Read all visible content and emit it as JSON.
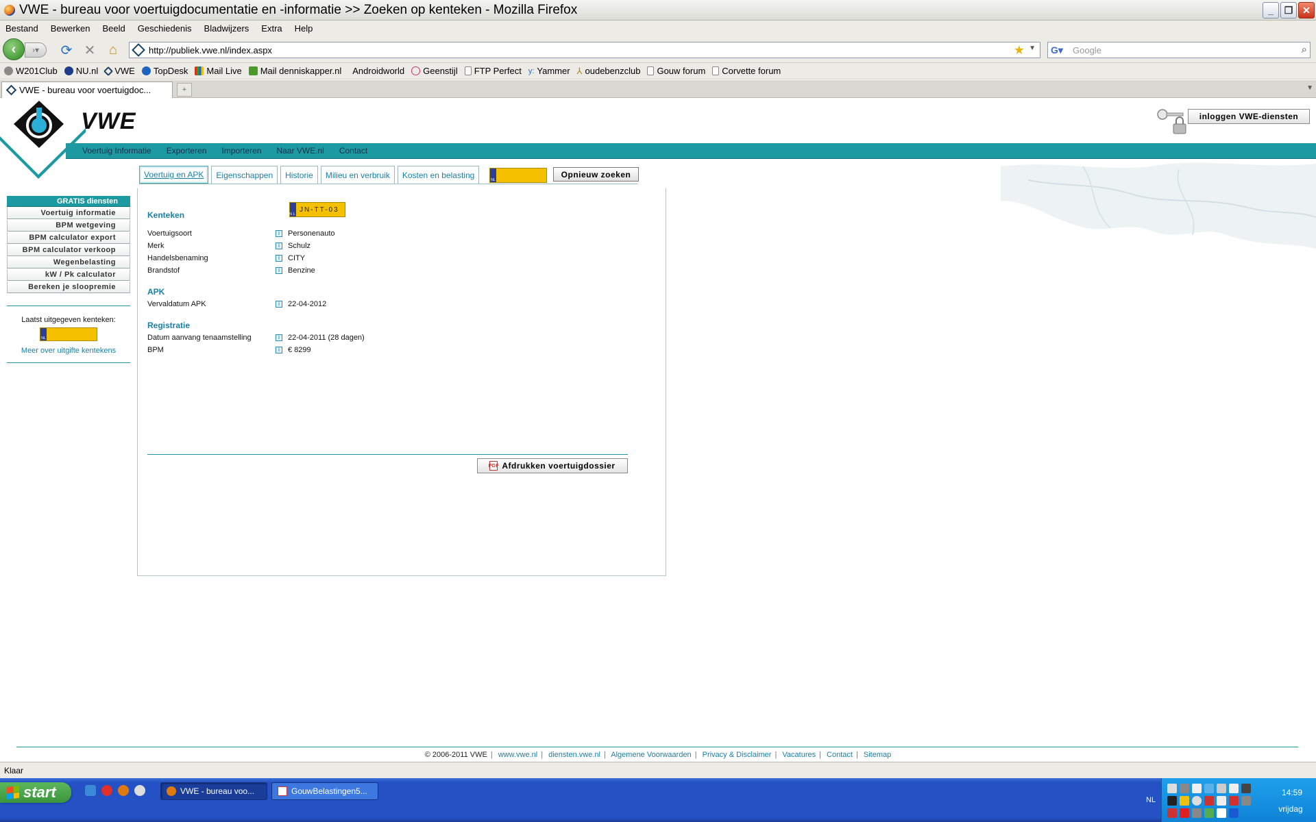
{
  "window": {
    "title": "VWE - bureau voor voertuigdocumentatie en -informatie >> Zoeken op kenteken - Mozilla Firefox",
    "controls": [
      "_",
      "❐",
      "✕"
    ]
  },
  "menu": [
    "Bestand",
    "Bewerken",
    "Beeld",
    "Geschiedenis",
    "Bladwijzers",
    "Extra",
    "Help"
  ],
  "nav": {
    "url": "http://publiek.vwe.nl/index.aspx",
    "search_placeholder": "Google"
  },
  "bookmarks": [
    {
      "label": "W201Club",
      "color": "#8a8a8a"
    },
    {
      "label": "NU.nl",
      "color": "#1d3c8c"
    },
    {
      "label": "VWE",
      "color": "#1a4060"
    },
    {
      "label": "TopDesk",
      "color": "#1d64c0"
    },
    {
      "label": "Mail Live",
      "color": "#e07a10"
    },
    {
      "label": "Mail denniskapper.nl",
      "color": "#4a9a2a"
    },
    {
      "label": "Androidworld",
      "color": "#ecebe6"
    },
    {
      "label": "Geenstijl",
      "color": "#d0307a"
    },
    {
      "label": "FTP Perfect",
      "color": "#c8c8c8"
    },
    {
      "label": "Yammer",
      "color": "#2d6fc0"
    },
    {
      "label": "oudebenzclub",
      "color": "#b08020"
    },
    {
      "label": "Gouw forum",
      "color": "#c8c8c8"
    },
    {
      "label": "Corvette forum",
      "color": "#c8c8c8"
    }
  ],
  "tab": {
    "title": "VWE - bureau voor voertuigdoc..."
  },
  "site": {
    "logo_text": "VWE",
    "login_label": "inloggen VWE-diensten",
    "main_nav": [
      "Voertuig Informatie",
      "Exporteren",
      "Importeren",
      "Naar VWE.nl",
      "Contact"
    ],
    "content_tabs": [
      "Voertuig en APK",
      "Eigenschappen",
      "Historie",
      "Milieu en verbruik",
      "Kosten en belasting"
    ],
    "new_search_label": "Opnieuw zoeken",
    "plate_country": "NL",
    "plate": "JN-TT-03",
    "sections": [
      {
        "title": "Kenteken",
        "rows": [
          {
            "label": "Voertuigsoort",
            "value": "Personenauto"
          },
          {
            "label": "Merk",
            "value": "Schulz"
          },
          {
            "label": "Handelsbenaming",
            "value": "CITY"
          },
          {
            "label": "Brandstof",
            "value": "Benzine"
          }
        ]
      },
      {
        "title": "APK",
        "rows": [
          {
            "label": "Vervaldatum APK",
            "value": "22-04-2012"
          }
        ]
      },
      {
        "title": "Registratie",
        "rows": [
          {
            "label": "Datum aanvang tenaamstelling",
            "value": "22-04-2011 (28 dagen)"
          },
          {
            "label": "BPM",
            "value": "€ 8299"
          }
        ]
      }
    ],
    "print_label": "Afdrukken voertuigdossier",
    "sidebar": {
      "header": "GRATIS diensten",
      "items": [
        "Voertuig informatie",
        "BPM wetgeving",
        "BPM calculator export",
        "BPM calculator verkoop",
        "Wegenbelasting",
        "kW / Pk calculator",
        "Bereken je sloopremie"
      ],
      "last_label": "Laatst uitgegeven kenteken:",
      "more_link": "Meer over uitgifte kentekens"
    },
    "footer": {
      "copyright": "© 2006-2011 VWE",
      "links": [
        "www.vwe.nl",
        "diensten.vwe.nl",
        "Algemene Voorwaarden",
        "Privacy & Disclaimer",
        "Vacatures",
        "Contact",
        "Sitemap"
      ]
    }
  },
  "status": {
    "text": "Klaar"
  },
  "taskbar": {
    "start": "start",
    "tasks": [
      {
        "label": "VWE - bureau voo...",
        "active": true
      },
      {
        "label": "GouwBelastingen5...",
        "active": false
      }
    ],
    "lang": "NL",
    "time": "14:59",
    "day": "vrijdag"
  }
}
